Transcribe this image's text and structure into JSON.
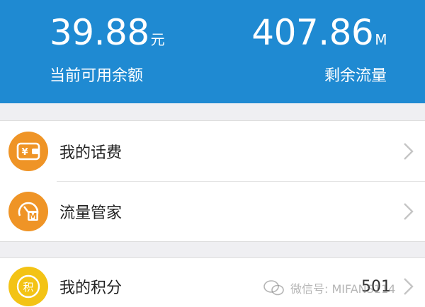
{
  "header": {
    "balance": {
      "value": "39.88",
      "unit": "元",
      "label": "当前可用余额"
    },
    "data_left": {
      "value": "407.86",
      "unit": "M",
      "label": "剩余流量"
    }
  },
  "menu": {
    "items": [
      {
        "label": "我的话费",
        "icon": "wallet-yen-icon"
      },
      {
        "label": "流量管家",
        "icon": "speedometer-m-icon"
      }
    ]
  },
  "points": {
    "label": "我的积分",
    "icon_text": "积",
    "value": "501"
  },
  "watermark": {
    "text": "微信号: MIFANS114"
  },
  "colors": {
    "header_bg": "#1f8ad2",
    "orange_icon": "#ef9426",
    "yellow_icon": "#f3c315"
  }
}
